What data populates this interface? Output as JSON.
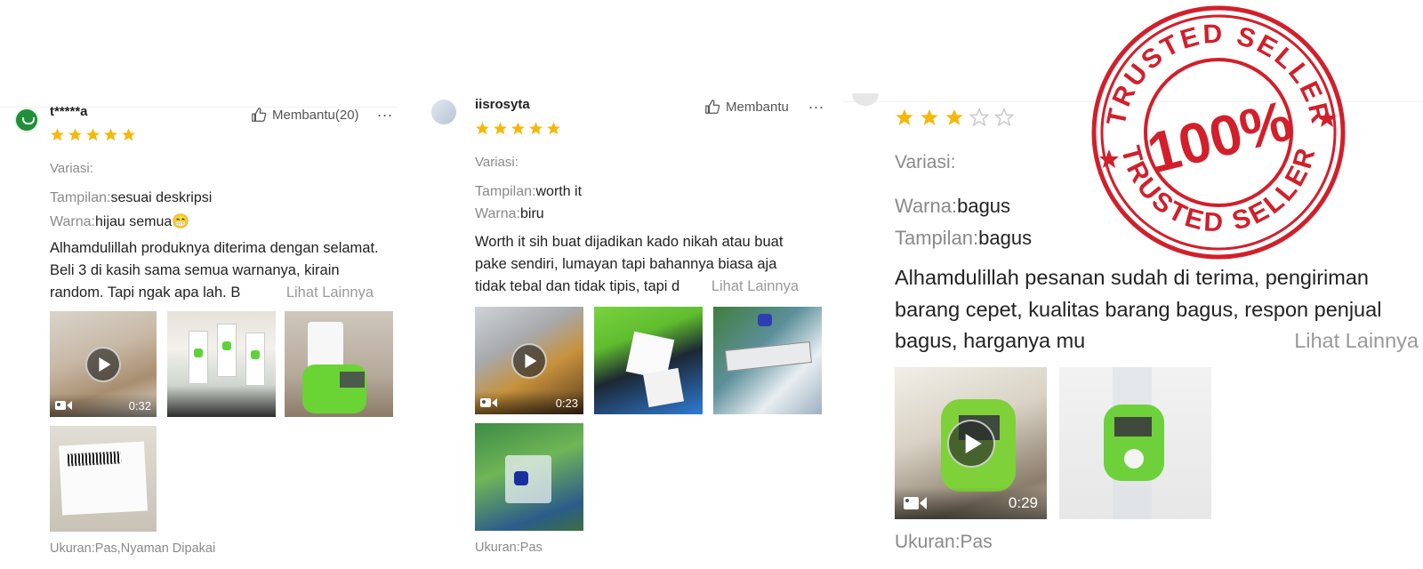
{
  "colors": {
    "star": "#f5b70a",
    "star_empty": "#c9c9c9",
    "stamp": "#d21f2a",
    "avatar_green": "#1f8f3a"
  },
  "reviews": [
    {
      "username": "t*****a",
      "helpful_label": "Membantu(20)",
      "more_icon": "...",
      "rating": 5,
      "variation_label": "Variasi:",
      "attributes": [
        {
          "label": "Tampilan:",
          "value": "sesuai deskripsi"
        },
        {
          "label": "Warna:",
          "value": "hijau semua😁"
        }
      ],
      "text": "Alhamdulillah produknya diterima dengan selamat. Beli 3 di kasih sama semua warnanya, kirain random. Tapi ngak apa lah. B",
      "see_more": "Lihat Lainnya",
      "video_duration": "0:32",
      "footer": "Ukuran:Pas,Nyaman Dipakai"
    },
    {
      "username": "iisrosyta",
      "helpful_label": "Membantu",
      "more_icon": "...",
      "rating": 5,
      "variation_label": "Variasi:",
      "attributes": [
        {
          "label": "Tampilan:",
          "value": "worth it"
        },
        {
          "label": "Warna:",
          "value": "biru"
        }
      ],
      "text": "Worth it sih buat dijadikan kado nikah atau buat pake sendiri, lumayan tapi bahannya biasa aja tidak tebal dan tidak tipis, tapi d",
      "see_more": "Lihat Lainnya",
      "video_duration": "0:23",
      "footer": "Ukuran:Pas"
    },
    {
      "rating": 3,
      "variation_label": "Variasi:",
      "attributes": [
        {
          "label": "Warna:",
          "value": "bagus"
        },
        {
          "label": "Tampilan:",
          "value": "bagus"
        }
      ],
      "text": "Alhamdulillah pesanan sudah di terima, pengiriman barang cepet, kualitas barang bagus, respon penjual bagus, harganya mu",
      "see_more": "Lihat Lainnya",
      "video_duration": "0:29",
      "footer": "Ukuran:Pas"
    }
  ],
  "stamp": {
    "top_text": "TRUSTED SELLER",
    "bottom_text": "TRUSTED SELLER",
    "center_text": "100%"
  }
}
